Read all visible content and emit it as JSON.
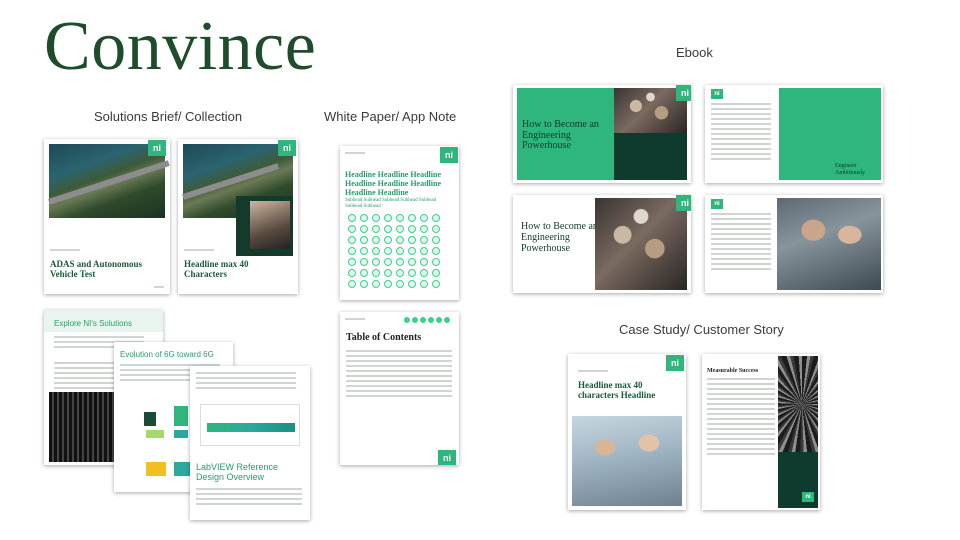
{
  "title": "Convince",
  "sections": {
    "solutions": "Solutions Brief/ Collection",
    "whitepaper": "White Paper/ App Note",
    "ebook": "Ebook",
    "casestudy": "Case Study/ Customer Story"
  },
  "cards": {
    "adas_title": "ADAS and Autonomous Vehicle Test",
    "headline40": "Headline max 40 Characters",
    "wp_headline": "Headline Headline Headline Headline Headline Headline Headline Headline",
    "wp_subhead": "Subhead Subhead Subhead Subhead Subhead Subhead Subhead",
    "toc_title": "Table of Contents",
    "explore": "Explore NI's Solutions",
    "evolution": "Evolution of 6G toward 6G",
    "labview": "LabVIEW Reference Design Overview",
    "ebook_title": "How to Become an Engineering Powerhouse",
    "ebook_tagline": "Engineer Ambitiously",
    "case_headline": "Headline max 40 characters Headline",
    "case_side": "Measurable Success"
  },
  "colors": {
    "brand_green": "#2eb67d",
    "dark_green": "#1f4d2c",
    "deep_green": "#0f3b2e"
  },
  "logo": "ni"
}
